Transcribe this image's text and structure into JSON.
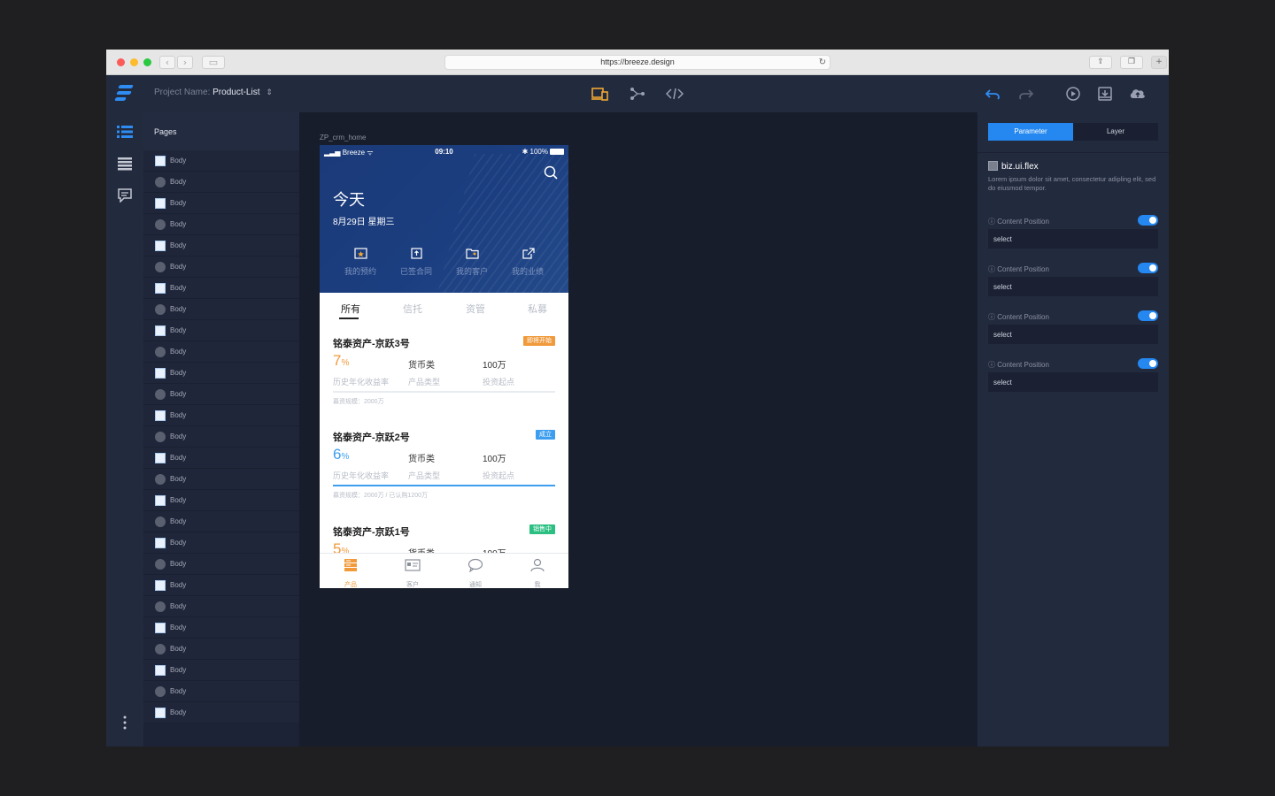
{
  "browser": {
    "url": "https://breeze.design"
  },
  "app": {
    "project_label": "Project Name:",
    "project_name": "Product-List"
  },
  "pages": {
    "title": "Pages",
    "items": [
      "Body",
      "Body",
      "Body",
      "Body",
      "Body",
      "Body",
      "Body",
      "Body",
      "Body",
      "Body",
      "Body",
      "Body",
      "Body",
      "Body",
      "Body",
      "Body",
      "Body",
      "Body",
      "Body",
      "Body",
      "Body",
      "Body",
      "Body",
      "Body",
      "Body",
      "Body",
      "Body"
    ]
  },
  "canvas": {
    "frame_label": "ZP_crm_home"
  },
  "phone": {
    "status": {
      "carrier": "Breeze",
      "time": "09:10",
      "battery": "100%"
    },
    "today": "今天",
    "date": "8月29日 星期三",
    "quick_actions": [
      "我的预约",
      "已签合同",
      "我的客户",
      "我的业绩"
    ],
    "tabs": [
      "所有",
      "信托",
      "资管",
      "私募"
    ],
    "products": [
      {
        "name": "铭泰资产-京跃3号",
        "badge": "即将开始",
        "badge_color": "#f09a3c",
        "rate": "7",
        "rate_unit": "%",
        "rate_color": "#f09a3c",
        "type": "货币类",
        "min": "100万",
        "rate_label": "历史年化收益率",
        "type_label": "产品类型",
        "min_label": "投资起点",
        "scale": "募资规模：2000万",
        "progress": 0
      },
      {
        "name": "铭泰资产-京跃2号",
        "badge": "成立",
        "badge_color": "#3d9ef0",
        "rate": "6",
        "rate_unit": "%",
        "rate_color": "#3d9ef0",
        "type": "货币类",
        "min": "100万",
        "rate_label": "历史年化收益率",
        "type_label": "产品类型",
        "min_label": "投资起点",
        "scale": "募资规模：2000万 / 已认购1200万",
        "progress": 1.0
      },
      {
        "name": "铭泰资产-京跃1号",
        "badge": "销售中",
        "badge_color": "#2bbf82",
        "rate": "5",
        "rate_unit": "%",
        "rate_color": "#f09a3c",
        "type": "货币类",
        "min": "100万"
      }
    ],
    "bottom_nav": [
      "产品",
      "客户",
      "通知",
      "我"
    ]
  },
  "inspector": {
    "tabs": [
      "Parameter",
      "Layer"
    ],
    "component_name": "biz.ui.flex",
    "component_desc": "Lorem ipsum dolor sit amet, consectetur adipling elit, sed do eiusmod tempor.",
    "props": [
      {
        "label": "Content Position",
        "value": "select",
        "enabled": true
      },
      {
        "label": "Content Position",
        "value": "select",
        "enabled": true
      },
      {
        "label": "Content Position",
        "value": "select",
        "enabled": true
      },
      {
        "label": "Content Position",
        "value": "select",
        "enabled": true
      }
    ]
  },
  "colors": {
    "accent": "#2588f0",
    "active_tool": "#f0a832",
    "brand_orange": "#f09a3c"
  }
}
